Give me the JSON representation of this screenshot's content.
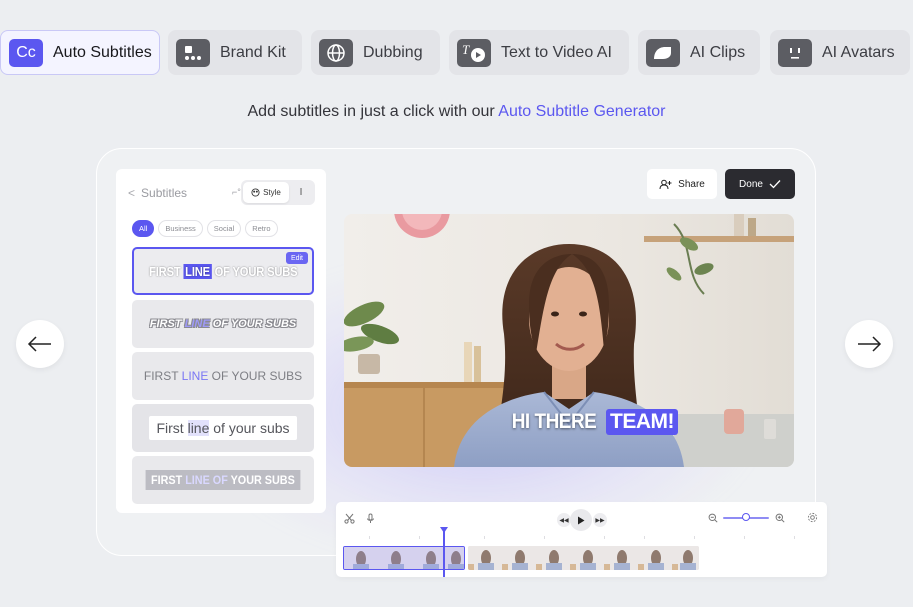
{
  "tabs": [
    {
      "label": "Auto Subtitles",
      "icon": "cc-icon",
      "icon_text": "Cc",
      "active": true
    },
    {
      "label": "Brand Kit",
      "icon": "brand-kit-icon",
      "active": false
    },
    {
      "label": "Dubbing",
      "icon": "globe-icon",
      "active": false
    },
    {
      "label": "Text to Video AI",
      "icon": "text-to-video-icon",
      "active": false
    },
    {
      "label": "AI Clips",
      "icon": "clips-icon",
      "active": false
    },
    {
      "label": "AI Avatars",
      "icon": "avatar-icon",
      "active": false
    }
  ],
  "headline": {
    "text": "Add subtitles in just a click with our ",
    "link": "Auto Subtitle Generator"
  },
  "panel": {
    "title": "Subtitles",
    "mini_label": "⌐°",
    "style_label": "Style",
    "style_other": "I",
    "filters": [
      "All",
      "Business",
      "Social",
      "Retro"
    ],
    "active_filter": "All",
    "edit_label": "Edit",
    "presets": [
      {
        "pre": "FIRST ",
        "hl": "LINE",
        "post": " OF YOUR SUBS"
      },
      {
        "pre": "FIRST ",
        "hl": "LINE",
        "post": " OF YOUR SUBS"
      },
      {
        "pre": "FIRST ",
        "hl": "LINE",
        "post": " OF YOUR SUBS"
      },
      {
        "pre": "First ",
        "hl": "line",
        "post": " of your subs"
      },
      {
        "pre": "FIRST ",
        "hl": "LINE OF",
        "post": " YOUR SUBS"
      }
    ]
  },
  "actions": {
    "share": "Share",
    "done": "Done"
  },
  "video": {
    "caption_plain": "HI THERE",
    "caption_highlight": "TEAM!"
  },
  "colors": {
    "accent": "#5b57f0",
    "done_bg": "#2b2b30",
    "page_bg": "#eceef1"
  }
}
